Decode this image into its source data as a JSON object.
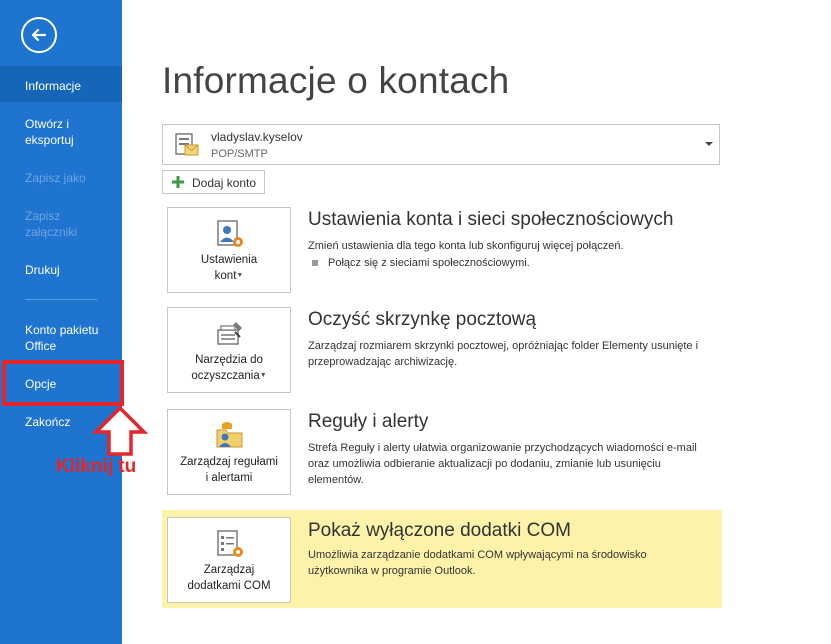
{
  "sidebar": {
    "items": [
      {
        "label": "Informacje",
        "active": true
      },
      {
        "label": "Otwórz i eksportuj"
      },
      {
        "label": "Zapisz jako",
        "disabled": true
      },
      {
        "label": "Zapisz załączniki",
        "disabled": true
      },
      {
        "label": "Drukuj"
      },
      {
        "label": "Konto pakietu Office"
      },
      {
        "label": "Opcje"
      },
      {
        "label": "Zakończ"
      }
    ],
    "accent": "#1e74cf"
  },
  "annotation": {
    "text": "Kliknij tu",
    "color": "#e5252a"
  },
  "main": {
    "title": "Informacje o kontach",
    "account": {
      "name": "vladyslav.kyselov",
      "type": "POP/SMTP"
    },
    "add_account_label": "Dodaj konto",
    "sections": [
      {
        "tile_label_1": "Ustawienia",
        "tile_label_2": "kont",
        "title": "Ustawienia konta i sieci społecznościowych",
        "desc": "Zmień ustawienia dla tego konta lub skonfiguruj więcej połączeń.",
        "link": "Połącz się z sieciami społecznościowymi."
      },
      {
        "tile_label_1": "Narzędzia do",
        "tile_label_2": "oczyszczania",
        "title": "Oczyść skrzynkę pocztową",
        "desc": "Zarządzaj rozmiarem skrzynki pocztowej, opróżniając folder Elementy usunięte i przeprowadzając archiwizację."
      },
      {
        "tile_label_1": "Zarządzaj regułami",
        "tile_label_2": "i alertami",
        "title": "Reguły i alerty",
        "desc": "Strefa Reguły i alerty ułatwia organizowanie przychodzących wiadomości e-mail oraz umożliwia odbieranie aktualizacji po dodaniu, zmianie lub usunięciu elementów."
      },
      {
        "tile_label_1": "Zarządzaj",
        "tile_label_2": "dodatkami COM",
        "title": "Pokaż wyłączone dodatki COM",
        "desc": "Umożliwia zarządzanie dodatkami COM wpływającymi na środowisko użytkownika w programie Outlook.",
        "highlight": "#fcf2a9"
      }
    ]
  }
}
